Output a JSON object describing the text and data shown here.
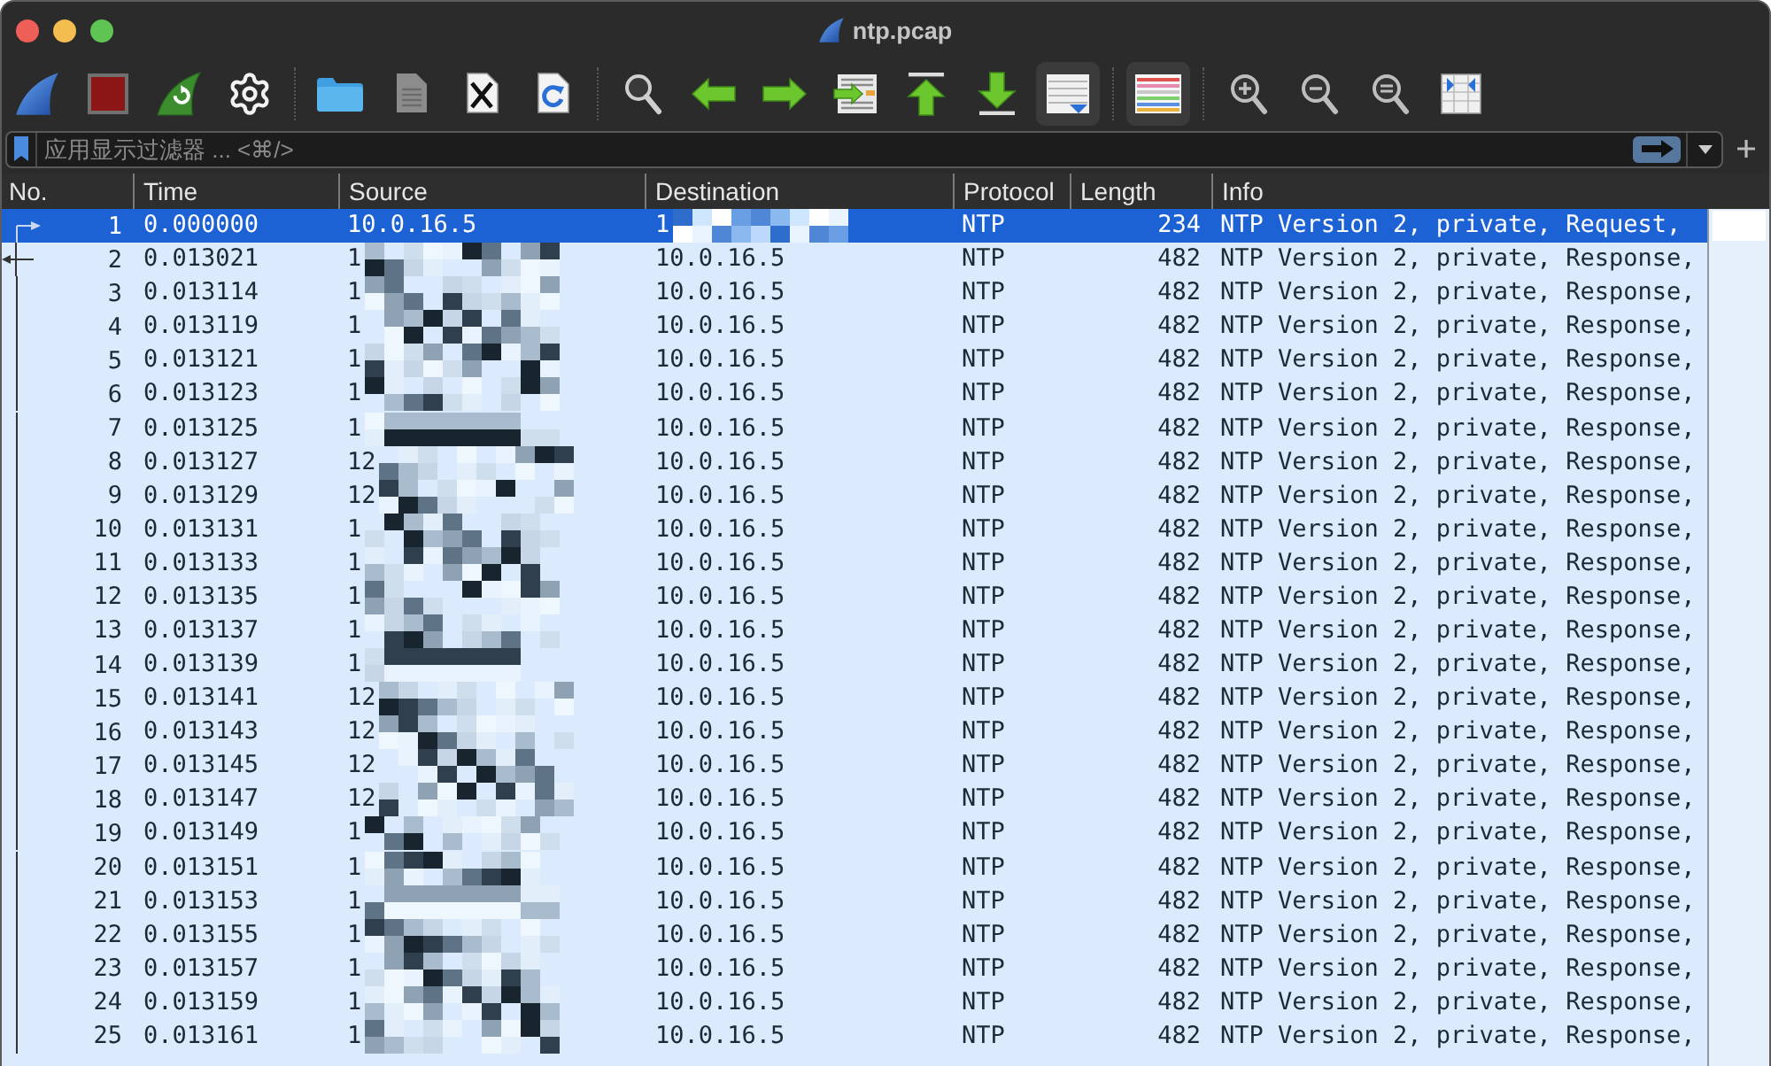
{
  "window": {
    "title": "ntp.pcap"
  },
  "toolbar": {
    "groups": [
      {
        "buttons": [
          {
            "pressed": false
          },
          {
            "pressed": false
          },
          {
            "pressed": false
          },
          {
            "pressed": false
          }
        ]
      },
      {
        "buttons": [
          {
            "pressed": false
          },
          {
            "pressed": false
          },
          {
            "pressed": false
          },
          {
            "pressed": false
          }
        ]
      },
      {
        "buttons": [
          {
            "pressed": false
          },
          {
            "pressed": false
          },
          {
            "pressed": false
          },
          {
            "pressed": false
          },
          {
            "pressed": false
          },
          {
            "pressed": false
          },
          {
            "pressed": true
          }
        ]
      },
      {
        "buttons": [
          {
            "pressed": true
          }
        ]
      },
      {
        "buttons": [
          {
            "pressed": false
          },
          {
            "pressed": false
          },
          {
            "pressed": false
          },
          {
            "pressed": false
          }
        ]
      }
    ]
  },
  "filter": {
    "placeholder": "应用显示过滤器 ... <⌘/>"
  },
  "table": {
    "columns": [
      "No.",
      "Time",
      "Source",
      "Destination",
      "Protocol",
      "Length",
      "Info"
    ],
    "rows": [
      {
        "no": "1",
        "time": "0.000000",
        "source": "10.0.16.5",
        "source_redacted": false,
        "destination": "1",
        "destination_redacted": true,
        "protocol": "NTP",
        "length": "234",
        "info": "NTP Version 2, private, Request,",
        "selected": true,
        "kind": "request"
      },
      {
        "no": "2",
        "time": "0.013021",
        "source": "1",
        "source_redacted": true,
        "destination": "10.0.16.5",
        "destination_redacted": false,
        "protocol": "NTP",
        "length": "482",
        "info": "NTP Version 2, private, Response,",
        "selected": false,
        "kind": "response"
      },
      {
        "no": "3",
        "time": "0.013114",
        "source": "1",
        "source_redacted": true,
        "destination": "10.0.16.5",
        "destination_redacted": false,
        "protocol": "NTP",
        "length": "482",
        "info": "NTP Version 2, private, Response,",
        "selected": false,
        "kind": "conversation"
      },
      {
        "no": "4",
        "time": "0.013119",
        "source": "1",
        "source_redacted": true,
        "destination": "10.0.16.5",
        "destination_redacted": false,
        "protocol": "NTP",
        "length": "482",
        "info": "NTP Version 2, private, Response,",
        "selected": false,
        "kind": "conversation"
      },
      {
        "no": "5",
        "time": "0.013121",
        "source": "1",
        "source_redacted": true,
        "destination": "10.0.16.5",
        "destination_redacted": false,
        "protocol": "NTP",
        "length": "482",
        "info": "NTP Version 2, private, Response,",
        "selected": false,
        "kind": "conversation"
      },
      {
        "no": "6",
        "time": "0.013123",
        "source": "1",
        "source_redacted": true,
        "destination": "10.0.16.5",
        "destination_redacted": false,
        "protocol": "NTP",
        "length": "482",
        "info": "NTP Version 2, private, Response,",
        "selected": false,
        "kind": "conversation"
      },
      {
        "no": "7",
        "time": "0.013125",
        "source": "1",
        "source_redacted": true,
        "destination": "10.0.16.5",
        "destination_redacted": false,
        "protocol": "NTP",
        "length": "482",
        "info": "NTP Version 2, private, Response,",
        "selected": false,
        "kind": "conversation"
      },
      {
        "no": "8",
        "time": "0.013127",
        "source": "12",
        "source_redacted": true,
        "destination": "10.0.16.5",
        "destination_redacted": false,
        "protocol": "NTP",
        "length": "482",
        "info": "NTP Version 2, private, Response,",
        "selected": false,
        "kind": "conversation"
      },
      {
        "no": "9",
        "time": "0.013129",
        "source": "12",
        "source_redacted": true,
        "destination": "10.0.16.5",
        "destination_redacted": false,
        "protocol": "NTP",
        "length": "482",
        "info": "NTP Version 2, private, Response,",
        "selected": false,
        "kind": "conversation"
      },
      {
        "no": "10",
        "time": "0.013131",
        "source": "1",
        "source_redacted": true,
        "destination": "10.0.16.5",
        "destination_redacted": false,
        "protocol": "NTP",
        "length": "482",
        "info": "NTP Version 2, private, Response,",
        "selected": false,
        "kind": "conversation"
      },
      {
        "no": "11",
        "time": "0.013133",
        "source": "1",
        "source_redacted": true,
        "destination": "10.0.16.5",
        "destination_redacted": false,
        "protocol": "NTP",
        "length": "482",
        "info": "NTP Version 2, private, Response,",
        "selected": false,
        "kind": "conversation"
      },
      {
        "no": "12",
        "time": "0.013135",
        "source": "1",
        "source_redacted": true,
        "destination": "10.0.16.5",
        "destination_redacted": false,
        "protocol": "NTP",
        "length": "482",
        "info": "NTP Version 2, private, Response,",
        "selected": false,
        "kind": "conversation"
      },
      {
        "no": "13",
        "time": "0.013137",
        "source": "1",
        "source_redacted": true,
        "destination": "10.0.16.5",
        "destination_redacted": false,
        "protocol": "NTP",
        "length": "482",
        "info": "NTP Version 2, private, Response,",
        "selected": false,
        "kind": "conversation"
      },
      {
        "no": "14",
        "time": "0.013139",
        "source": "1",
        "source_redacted": true,
        "destination": "10.0.16.5",
        "destination_redacted": false,
        "protocol": "NTP",
        "length": "482",
        "info": "NTP Version 2, private, Response,",
        "selected": false,
        "kind": "conversation"
      },
      {
        "no": "15",
        "time": "0.013141",
        "source": "12",
        "source_redacted": true,
        "destination": "10.0.16.5",
        "destination_redacted": false,
        "protocol": "NTP",
        "length": "482",
        "info": "NTP Version 2, private, Response,",
        "selected": false,
        "kind": "conversation"
      },
      {
        "no": "16",
        "time": "0.013143",
        "source": "12",
        "source_redacted": true,
        "destination": "10.0.16.5",
        "destination_redacted": false,
        "protocol": "NTP",
        "length": "482",
        "info": "NTP Version 2, private, Response,",
        "selected": false,
        "kind": "conversation"
      },
      {
        "no": "17",
        "time": "0.013145",
        "source": "12",
        "source_redacted": true,
        "destination": "10.0.16.5",
        "destination_redacted": false,
        "protocol": "NTP",
        "length": "482",
        "info": "NTP Version 2, private, Response,",
        "selected": false,
        "kind": "conversation"
      },
      {
        "no": "18",
        "time": "0.013147",
        "source": "12",
        "source_redacted": true,
        "destination": "10.0.16.5",
        "destination_redacted": false,
        "protocol": "NTP",
        "length": "482",
        "info": "NTP Version 2, private, Response,",
        "selected": false,
        "kind": "conversation"
      },
      {
        "no": "19",
        "time": "0.013149",
        "source": "1",
        "source_redacted": true,
        "destination": "10.0.16.5",
        "destination_redacted": false,
        "protocol": "NTP",
        "length": "482",
        "info": "NTP Version 2, private, Response,",
        "selected": false,
        "kind": "conversation"
      },
      {
        "no": "20",
        "time": "0.013151",
        "source": "1",
        "source_redacted": true,
        "destination": "10.0.16.5",
        "destination_redacted": false,
        "protocol": "NTP",
        "length": "482",
        "info": "NTP Version 2, private, Response,",
        "selected": false,
        "kind": "conversation"
      },
      {
        "no": "21",
        "time": "0.013153",
        "source": "1",
        "source_redacted": true,
        "destination": "10.0.16.5",
        "destination_redacted": false,
        "protocol": "NTP",
        "length": "482",
        "info": "NTP Version 2, private, Response,",
        "selected": false,
        "kind": "conversation"
      },
      {
        "no": "22",
        "time": "0.013155",
        "source": "1",
        "source_redacted": true,
        "destination": "10.0.16.5",
        "destination_redacted": false,
        "protocol": "NTP",
        "length": "482",
        "info": "NTP Version 2, private, Response,",
        "selected": false,
        "kind": "conversation"
      },
      {
        "no": "23",
        "time": "0.013157",
        "source": "1",
        "source_redacted": true,
        "destination": "10.0.16.5",
        "destination_redacted": false,
        "protocol": "NTP",
        "length": "482",
        "info": "NTP Version 2, private, Response,",
        "selected": false,
        "kind": "conversation"
      },
      {
        "no": "24",
        "time": "0.013159",
        "source": "1",
        "source_redacted": true,
        "destination": "10.0.16.5",
        "destination_redacted": false,
        "protocol": "NTP",
        "length": "482",
        "info": "NTP Version 2, private, Response,",
        "selected": false,
        "kind": "conversation"
      },
      {
        "no": "25",
        "time": "0.013161",
        "source": "1",
        "source_redacted": true,
        "destination": "10.0.16.5",
        "destination_redacted": false,
        "protocol": "NTP",
        "length": "482",
        "info": "NTP Version 2, private, Response,",
        "selected": false,
        "kind": "conversation"
      }
    ]
  }
}
